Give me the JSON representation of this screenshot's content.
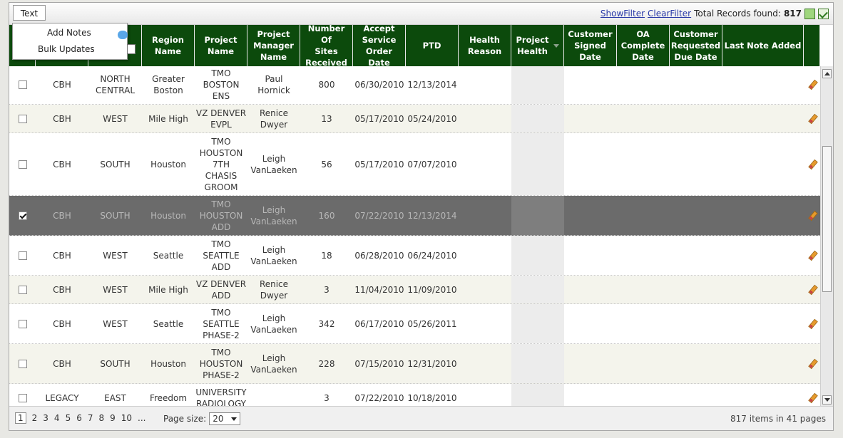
{
  "toolbar": {
    "text_button": "Text",
    "show_filter": "ShowFilter",
    "clear_filter": "ClearFilter",
    "total_label": "Total Records found:",
    "total_value": "817"
  },
  "menu": {
    "add_notes": "Add Notes",
    "bulk_updates": "Bulk Updates"
  },
  "columns": [
    "",
    "",
    "",
    "Region\nName",
    "Project\nName",
    "Project\nManager\nName",
    "Number Of\nSites\nReceived",
    "Accept\nService\nOrder Date",
    "PTD",
    "Health\nReason",
    "Project\nHealth",
    "Customer\nSigned\nDate",
    "OA\nComplete\nDate",
    "Customer\nRequested\nDue Date",
    "Last Note Added",
    ""
  ],
  "rows": [
    {
      "checked": false,
      "c1": "CBH",
      "c2": "NORTH\nCENTRAL",
      "region": "Greater\nBoston",
      "project": "TMO\nBOSTON\nENS",
      "manager": "Paul\nHornick",
      "sites": "800",
      "accept": "06/30/2010",
      "ptd": "12/13/2014"
    },
    {
      "checked": false,
      "c1": "CBH",
      "c2": "WEST",
      "region": "Mile High",
      "project": "VZ DENVER\nEVPL",
      "manager": "Renice\nDwyer",
      "sites": "13",
      "accept": "05/17/2010",
      "ptd": "05/24/2010"
    },
    {
      "checked": false,
      "c1": "CBH",
      "c2": "SOUTH",
      "region": "Houston",
      "project": "TMO\nHOUSTON\n7TH\nCHASIS\nGROOM",
      "manager": "Leigh\nVanLaeken",
      "sites": "56",
      "accept": "05/17/2010",
      "ptd": "07/07/2010"
    },
    {
      "checked": true,
      "c1": "CBH",
      "c2": "SOUTH",
      "region": "Houston",
      "project": "TMO\nHOUSTON\nADD",
      "manager": "Leigh\nVanLaeken",
      "sites": "160",
      "accept": "07/22/2010",
      "ptd": "12/13/2014"
    },
    {
      "checked": false,
      "c1": "CBH",
      "c2": "WEST",
      "region": "Seattle",
      "project": "TMO\nSEATTLE\nADD",
      "manager": "Leigh\nVanLaeken",
      "sites": "18",
      "accept": "06/28/2010",
      "ptd": "06/24/2010"
    },
    {
      "checked": false,
      "c1": "CBH",
      "c2": "WEST",
      "region": "Mile High",
      "project": "VZ DENVER\nADD",
      "manager": "Renice\nDwyer",
      "sites": "3",
      "accept": "11/04/2010",
      "ptd": "11/09/2010"
    },
    {
      "checked": false,
      "c1": "CBH",
      "c2": "WEST",
      "region": "Seattle",
      "project": "TMO\nSEATTLE\nPHASE-2",
      "manager": "Leigh\nVanLaeken",
      "sites": "342",
      "accept": "06/17/2010",
      "ptd": "05/26/2011"
    },
    {
      "checked": false,
      "c1": "CBH",
      "c2": "SOUTH",
      "region": "Houston",
      "project": "TMO\nHOUSTON\nPHASE-2",
      "manager": "Leigh\nVanLaeken",
      "sites": "228",
      "accept": "07/15/2010",
      "ptd": "12/31/2010"
    },
    {
      "checked": false,
      "c1": "LEGACY",
      "c2": "EAST",
      "region": "Freedom",
      "project": "UNIVERSITY\nRADIOLOGY",
      "manager": "",
      "sites": "3",
      "accept": "07/22/2010",
      "ptd": "10/18/2010"
    }
  ],
  "pager": {
    "pages": [
      "1",
      "2",
      "3",
      "4",
      "5",
      "6",
      "7",
      "8",
      "9",
      "10",
      "..."
    ],
    "current": "1",
    "page_size_label": "Page size:",
    "page_size": "20",
    "items_info": "817 items in 41 pages"
  }
}
